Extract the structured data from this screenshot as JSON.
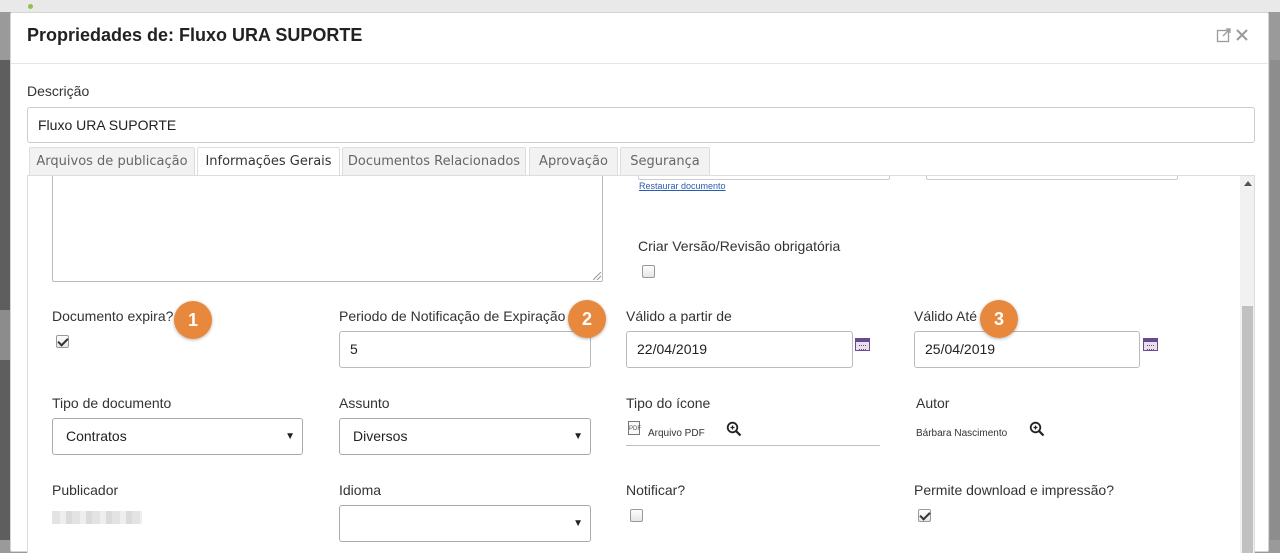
{
  "modal": {
    "title": "Propriedades de: Fluxo URA SUPORTE",
    "popout_icon": "popout-icon",
    "close_icon": "close-icon"
  },
  "description": {
    "label": "Descrição",
    "value": "Fluxo URA SUPORTE"
  },
  "tabs": [
    {
      "label": "Arquivos de publicação",
      "active": false
    },
    {
      "label": "Informações Gerais",
      "active": true
    },
    {
      "label": "Documentos Relacionados",
      "active": false
    },
    {
      "label": "Aprovação",
      "active": false
    },
    {
      "label": "Segurança",
      "active": false
    }
  ],
  "general": {
    "restore_link": "Restaurar documento",
    "mandatory_version_label": "Criar Versão/Revisão obrigatória",
    "mandatory_version_checked": false,
    "expires_label": "Documento expira?",
    "expires_checked": true,
    "notification_period_label": "Periodo de Notificação de Expiração",
    "notification_period_value": "5",
    "valid_from_label": "Válido a partir de",
    "valid_from_value": "22/04/2019",
    "valid_until_label": "Válido Até",
    "valid_until_value": "25/04/2019",
    "doc_type_label": "Tipo de documento",
    "doc_type_value": "Contratos",
    "subject_label": "Assunto",
    "subject_value": "Diversos",
    "icon_type_label": "Tipo do ícone",
    "icon_type_value": "Arquivo PDF",
    "author_label": "Autor",
    "author_value": "Bárbara Nascimento",
    "publisher_label": "Publicador",
    "language_label": "Idioma",
    "language_value": "",
    "notify_label": "Notificar?",
    "notify_checked": false,
    "allow_download_label": "Permite download e impressão?",
    "allow_download_checked": true
  },
  "badges": [
    "1",
    "2",
    "3"
  ],
  "colors": {
    "badge": "#e8883d",
    "link": "#2a5db0",
    "calendar_icon": "#6a4a8c"
  }
}
